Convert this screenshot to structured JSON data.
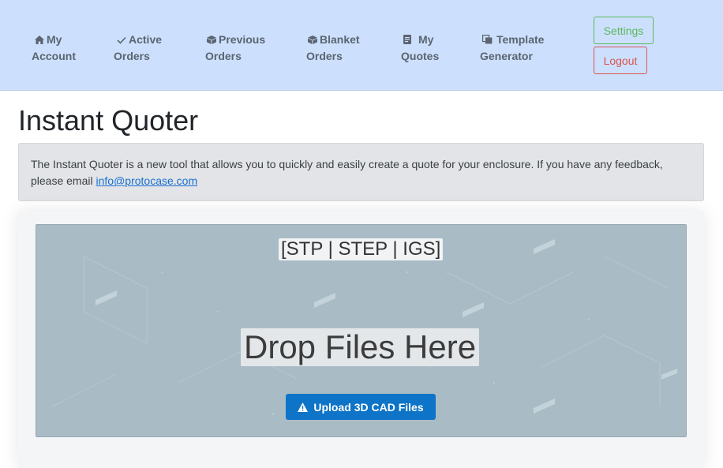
{
  "nav": {
    "items": [
      {
        "id": "my-account",
        "icon": "home-icon",
        "line1": "My",
        "line2": "Account"
      },
      {
        "id": "active-orders",
        "icon": "check-icon",
        "line1": "Active",
        "line2": "Orders"
      },
      {
        "id": "previous-orders",
        "icon": "box-icon",
        "line1": "Previous",
        "line2": "Orders"
      },
      {
        "id": "blanket-orders",
        "icon": "box-icon",
        "line1": "Blanket",
        "line2": "Orders"
      },
      {
        "id": "my-quotes",
        "icon": "document-icon",
        "line1": "My",
        "line2": "Quotes"
      },
      {
        "id": "template-generator",
        "icon": "copy-icon",
        "line1": "Template",
        "line2": "Generator"
      }
    ],
    "settings_label": "Settings",
    "logout_label": "Logout"
  },
  "page": {
    "title": "Instant Quoter",
    "info_text": "The Instant Quoter is a new tool that allows you to quickly and easily create a quote for your enclosure. If you have any feedback, please email ",
    "info_link": "info@protocase.com"
  },
  "dropzone": {
    "formats": "[STP | STEP | IGS]",
    "drop_text": "Drop Files Here",
    "upload_label": "Upload 3D CAD Files",
    "upload_icon": "warning-icon"
  },
  "colors": {
    "navbar_bg": "#cce0fd",
    "settings": "#5cb85c",
    "logout": "#d9534f",
    "upload_button": "#0d74c7",
    "dropzone_bg": "#a9bcc6",
    "link": "#1a6fd1"
  }
}
